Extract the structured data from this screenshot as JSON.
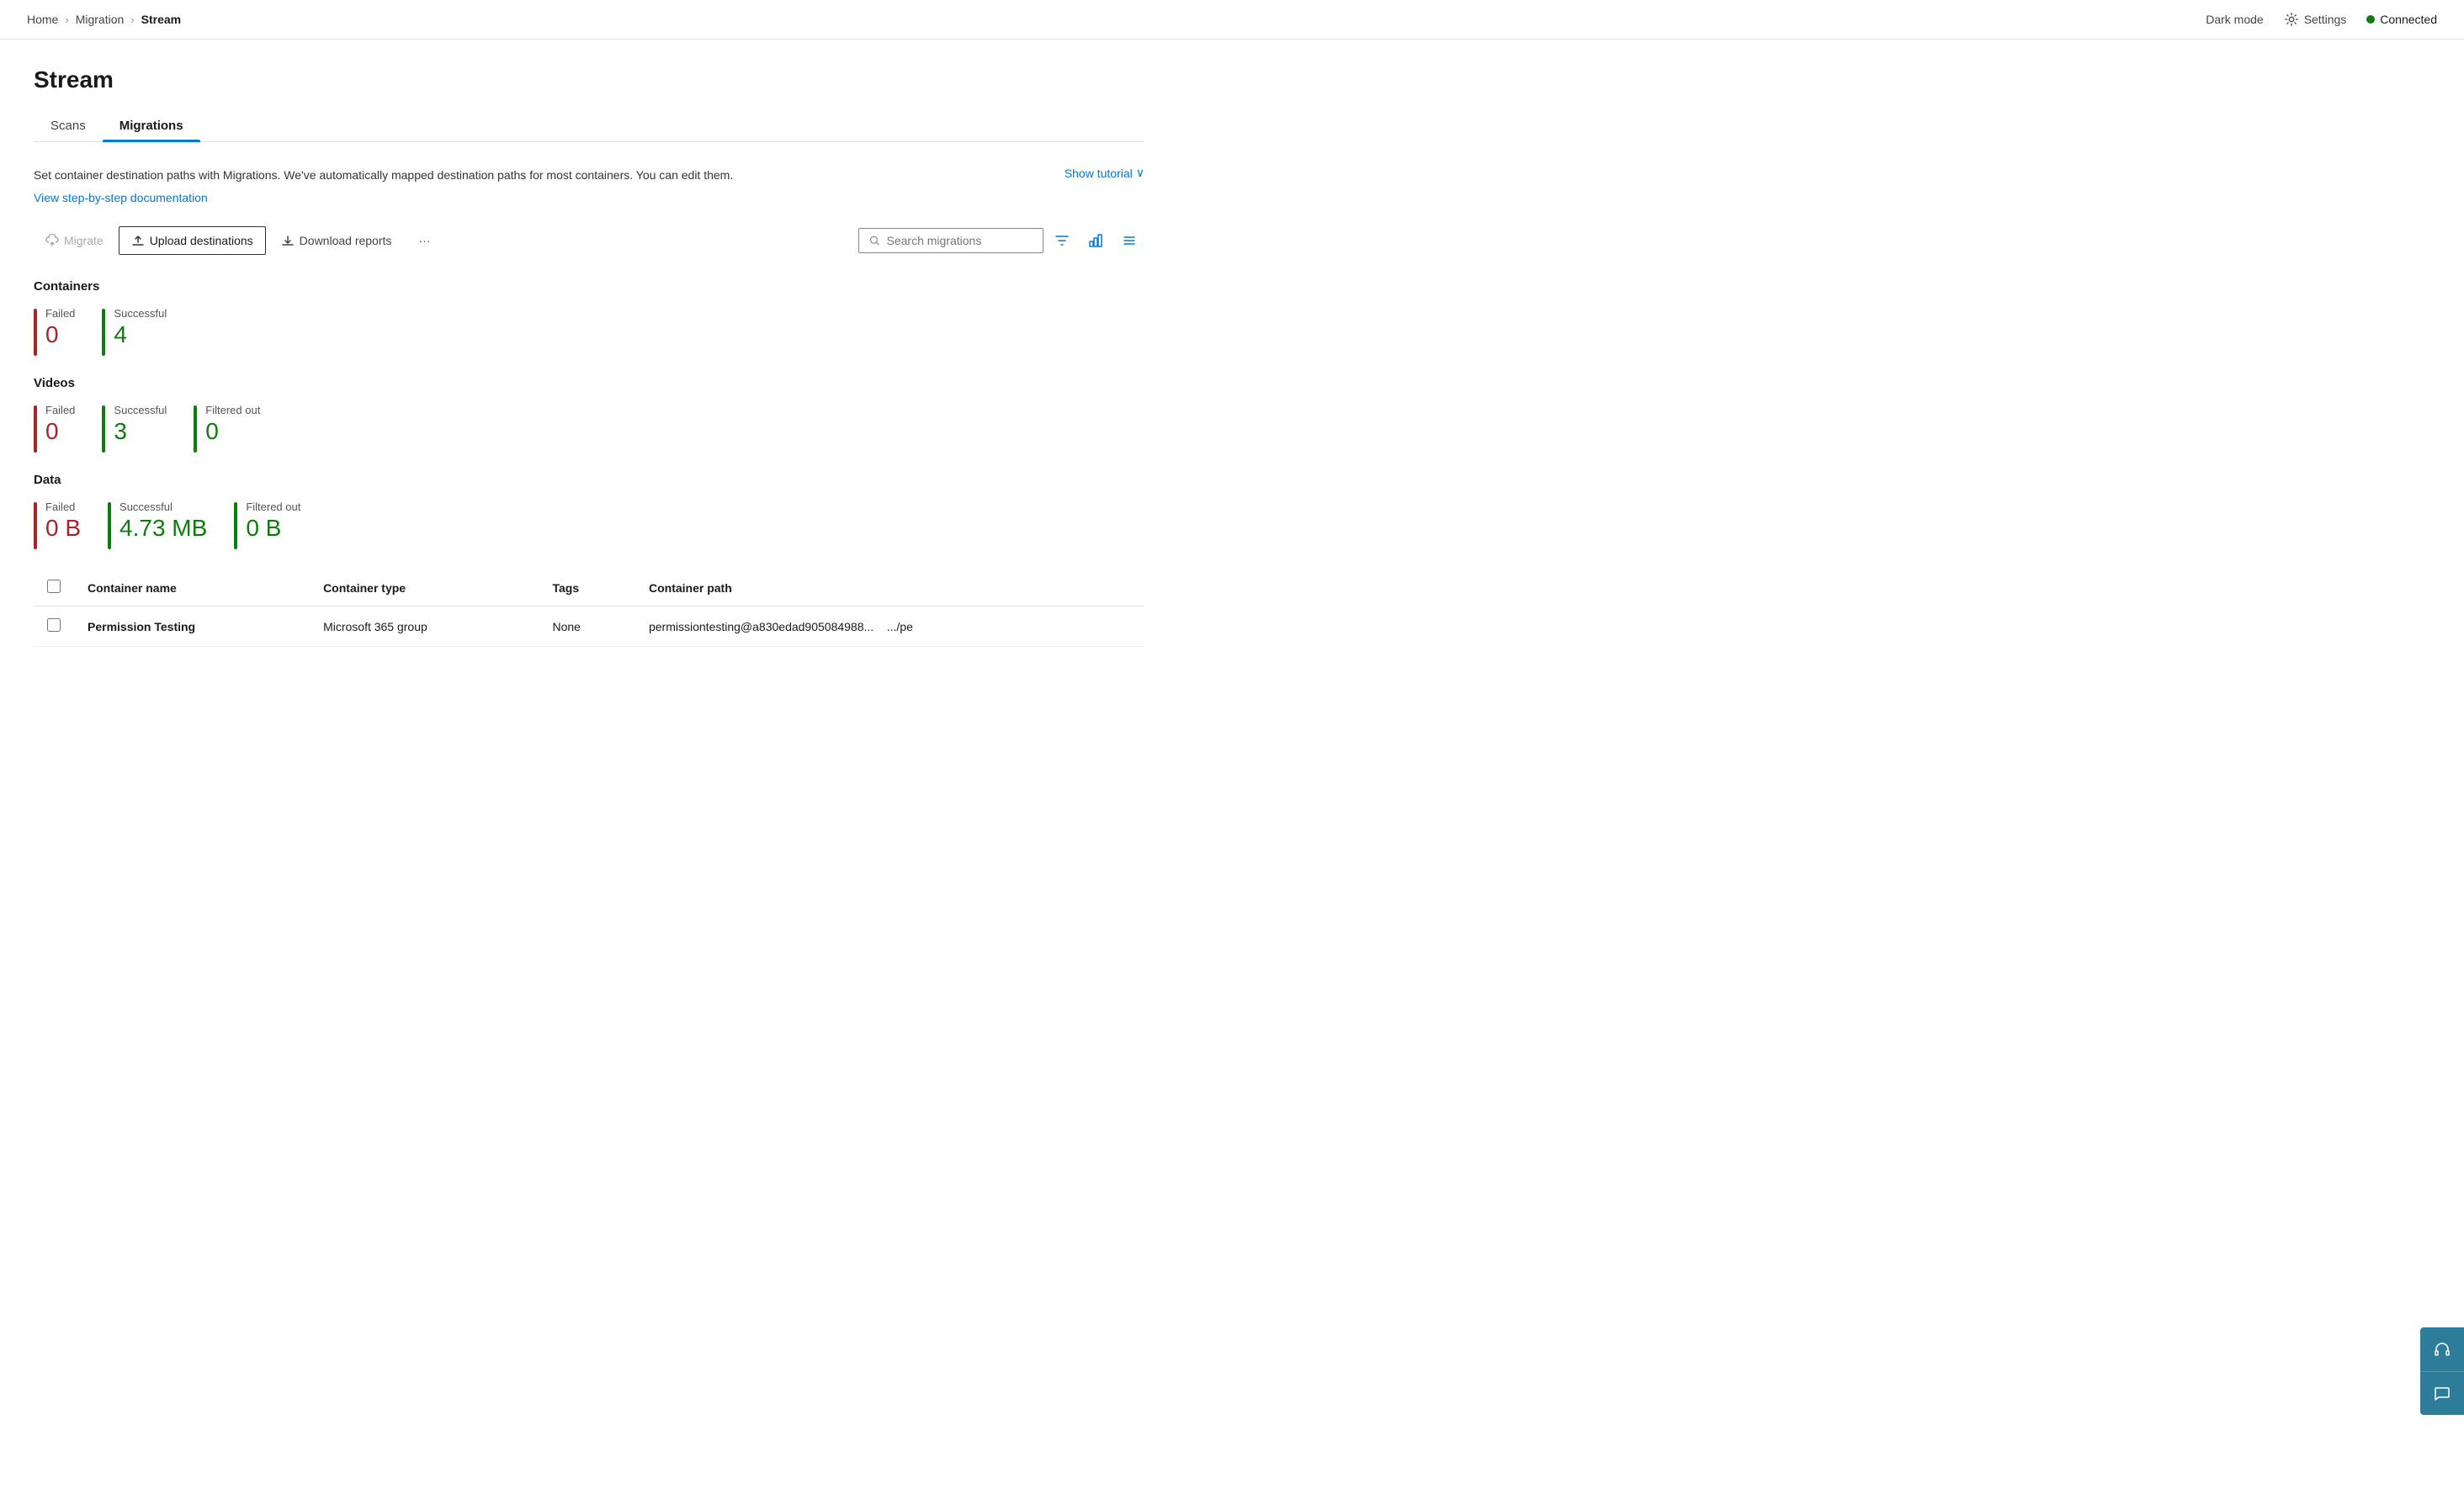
{
  "breadcrumb": {
    "home": "Home",
    "migration": "Migration",
    "current": "Stream"
  },
  "topbar": {
    "dark_mode": "Dark mode",
    "settings": "Settings",
    "connected": "Connected"
  },
  "page": {
    "title": "Stream",
    "description": "Set container destination paths with Migrations. We've automatically mapped destination paths for most containers. You can edit them.",
    "doc_link": "View step-by-step documentation",
    "show_tutorial": "Show tutorial"
  },
  "tabs": [
    {
      "label": "Scans",
      "active": false
    },
    {
      "label": "Migrations",
      "active": true
    }
  ],
  "toolbar": {
    "migrate": "Migrate",
    "upload_destinations": "Upload destinations",
    "download_reports": "Download reports",
    "more": "···",
    "search_placeholder": "Search migrations"
  },
  "stats": {
    "containers": {
      "title": "Containers",
      "items": [
        {
          "label": "Failed",
          "value": "0",
          "color": "red"
        },
        {
          "label": "Successful",
          "value": "4",
          "color": "green"
        }
      ]
    },
    "videos": {
      "title": "Videos",
      "items": [
        {
          "label": "Failed",
          "value": "0",
          "color": "red"
        },
        {
          "label": "Successful",
          "value": "3",
          "color": "green"
        },
        {
          "label": "Filtered out",
          "value": "0",
          "color": "green"
        }
      ]
    },
    "data": {
      "title": "Data",
      "items": [
        {
          "label": "Failed",
          "value": "0 B",
          "color": "red"
        },
        {
          "label": "Successful",
          "value": "4.73 MB",
          "color": "green"
        },
        {
          "label": "Filtered out",
          "value": "0 B",
          "color": "green"
        }
      ]
    }
  },
  "table": {
    "headers": [
      "",
      "Container name",
      "Container type",
      "Tags",
      "Container path"
    ],
    "rows": [
      {
        "name": "Permission Testing",
        "type": "Microsoft 365 group",
        "tags": "None",
        "path": "permissiontesting@a830edad905084988...    .../pe"
      }
    ]
  }
}
